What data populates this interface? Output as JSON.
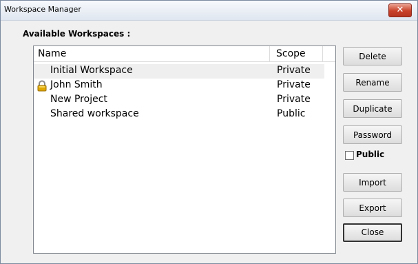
{
  "window": {
    "title": "Workspace Manager",
    "close_glyph": "✕"
  },
  "heading": "Available Workspaces :",
  "list": {
    "columns": {
      "name": "Name",
      "scope": "Scope"
    },
    "rows": [
      {
        "name": "Initial Workspace",
        "scope": "Private",
        "selected": true,
        "locked": false
      },
      {
        "name": "John Smith",
        "scope": "Private",
        "selected": false,
        "locked": true
      },
      {
        "name": "New Project",
        "scope": "Private",
        "selected": false,
        "locked": false
      },
      {
        "name": "Shared workspace",
        "scope": "Public",
        "selected": false,
        "locked": false
      }
    ]
  },
  "buttons": {
    "delete": "Delete",
    "rename": "Rename",
    "duplicate": "Duplicate",
    "password": "Password",
    "import": "Import",
    "export": "Export",
    "close": "Close"
  },
  "public_checkbox": {
    "label": "Public",
    "checked": false
  },
  "icons": {
    "lock": "lock-icon",
    "close": "close-icon"
  },
  "colors": {
    "lock_gold": "#e0a800",
    "close_red": "#c8412a"
  }
}
